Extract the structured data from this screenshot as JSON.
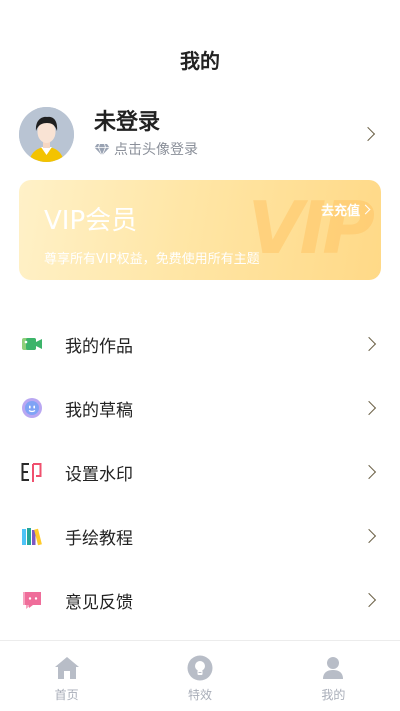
{
  "header": {
    "title": "我的"
  },
  "profile": {
    "name": "未登录",
    "hint": "点击头像登录"
  },
  "vip": {
    "title": "VIP会员",
    "cta": "去充值",
    "description": "尊享所有VIP权益，免费使用所有主题",
    "bg_letters": "VIP"
  },
  "menu": [
    {
      "label": "我的作品",
      "icon": "video-icon"
    },
    {
      "label": "我的草稿",
      "icon": "draft-face-icon"
    },
    {
      "label": "设置水印",
      "icon": "watermark-icon"
    },
    {
      "label": "手绘教程",
      "icon": "books-icon"
    },
    {
      "label": "意见反馈",
      "icon": "feedback-icon"
    }
  ],
  "tabbar": [
    {
      "label": "首页",
      "icon": "home-icon"
    },
    {
      "label": "特效",
      "icon": "effects-bulb-icon"
    },
    {
      "label": "我的",
      "icon": "profile-icon"
    }
  ],
  "colors": {
    "vip_gradient_start": "#fff1c8",
    "vip_gradient_end": "#ffd987",
    "tab_inactive": "#a8adb8",
    "chevron": "#6b6046"
  }
}
